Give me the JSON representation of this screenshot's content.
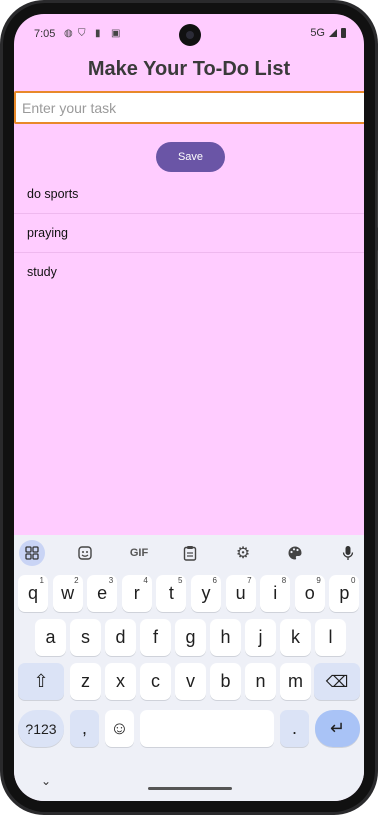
{
  "status_bar": {
    "time": "7:05",
    "network": "5G"
  },
  "app": {
    "title": "Make Your To-Do List",
    "input": {
      "value": "",
      "placeholder": "Enter your task"
    },
    "save_label": "Save",
    "tasks": [
      "do sports",
      "praying",
      "study"
    ]
  },
  "keyboard": {
    "toolbar": [
      "apps-grid-icon",
      "sticker-icon",
      "gif-icon",
      "clipboard-icon",
      "settings-icon",
      "palette-icon",
      "mic-icon"
    ],
    "gif_label": "GIF",
    "row1": [
      {
        "k": "q",
        "s": "1"
      },
      {
        "k": "w",
        "s": "2"
      },
      {
        "k": "e",
        "s": "3"
      },
      {
        "k": "r",
        "s": "4"
      },
      {
        "k": "t",
        "s": "5"
      },
      {
        "k": "y",
        "s": "6"
      },
      {
        "k": "u",
        "s": "7"
      },
      {
        "k": "i",
        "s": "8"
      },
      {
        "k": "o",
        "s": "9"
      },
      {
        "k": "p",
        "s": "0"
      }
    ],
    "row2": [
      "a",
      "s",
      "d",
      "f",
      "g",
      "h",
      "j",
      "k",
      "l"
    ],
    "row3": [
      "z",
      "x",
      "c",
      "v",
      "b",
      "n",
      "m"
    ],
    "symbols_label": "?123",
    "comma_label": ",",
    "period_label": ".",
    "shift_glyph": "⇧",
    "backspace_glyph": "⌫",
    "emoji_glyph": "☺",
    "enter_glyph": "↵",
    "collapse_glyph": "⌄"
  },
  "colors": {
    "screen_bg": "#ffccff",
    "accent": "#6a55a6",
    "input_border": "#e8892a"
  }
}
